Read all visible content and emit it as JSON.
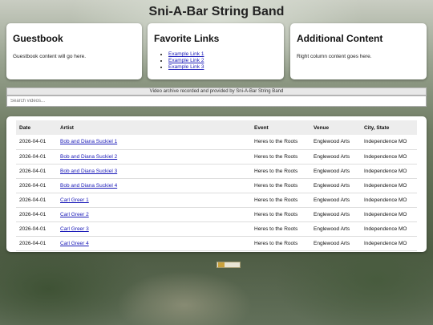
{
  "site": {
    "title": "Sni-A-Bar String Band"
  },
  "cards": {
    "guestbook": {
      "heading": "Guestbook",
      "text": "Guestbook content will go here."
    },
    "links": {
      "heading": "Favorite Links",
      "items": [
        "Example Link 1",
        "Example Link 2",
        "Example Link 3"
      ]
    },
    "additional": {
      "heading": "Additional Content",
      "text": "Right column content goes here."
    }
  },
  "archive": {
    "caption": "Video archive recorded and provided by Sni-A-Bar String Band",
    "search_placeholder": "Search videos..."
  },
  "table": {
    "headers": [
      "Date",
      "Artist",
      "Event",
      "Venue",
      "City, State"
    ],
    "rows": [
      {
        "date": "2026-04-01",
        "artist": "Bob and Diana Suckiel 1",
        "event": "Heres to the Roots",
        "venue": "Englewood Arts",
        "city": "Independence MO"
      },
      {
        "date": "2026-04-01",
        "artist": "Bob and Diana Suckiel 2",
        "event": "Heres to the Roots",
        "venue": "Englewood Arts",
        "city": "Independence MO"
      },
      {
        "date": "2026-04-01",
        "artist": "Bob and Diana Suckiel 3",
        "event": "Heres to the Roots",
        "venue": "Englewood Arts",
        "city": "Independence MO"
      },
      {
        "date": "2026-04-01",
        "artist": "Bob and Diana Suckiel 4",
        "event": "Heres to the Roots",
        "venue": "Englewood Arts",
        "city": "Independence MO"
      },
      {
        "date": "2026-04-01",
        "artist": "Carl Greer 1",
        "event": "Heres to the Roots",
        "venue": "Englewood Arts",
        "city": "Independence MO"
      },
      {
        "date": "2026-04-01",
        "artist": "Carl Greer 2",
        "event": "Heres to the Roots",
        "venue": "Englewood Arts",
        "city": "Independence MO"
      },
      {
        "date": "2026-04-01",
        "artist": "Carl Greer 3",
        "event": "Heres to the Roots",
        "venue": "Englewood Arts",
        "city": "Independence MO"
      },
      {
        "date": "2026-04-01",
        "artist": "Carl Greer 4",
        "event": "Heres to the Roots",
        "venue": "Englewood Arts",
        "city": "Independence MO"
      }
    ]
  },
  "colors": {
    "link": "#1a1ab8",
    "card_bg": "#ffffff",
    "header_row_bg": "#ededed"
  },
  "icons": {
    "footer_badge": "hit-counter-badge-icon"
  }
}
